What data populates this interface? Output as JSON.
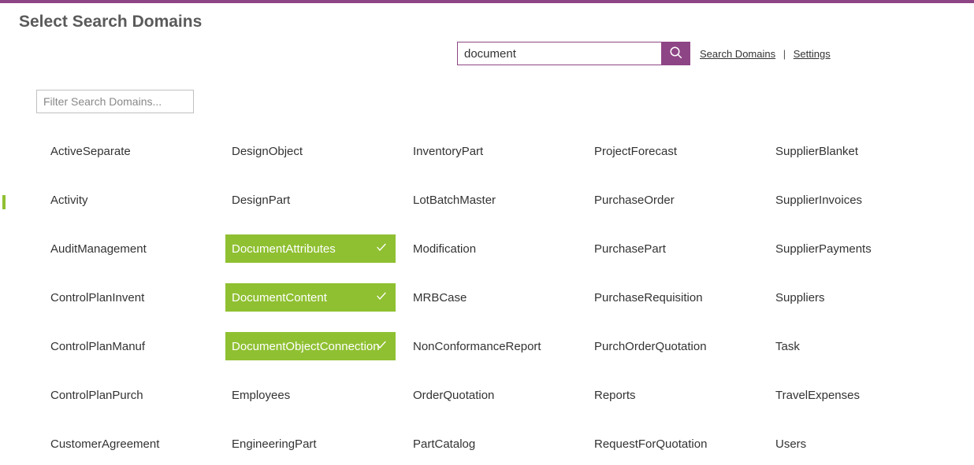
{
  "title": "Select Search Domains",
  "search": {
    "value": "document"
  },
  "links": {
    "search_domains": "Search Domains",
    "settings": "Settings"
  },
  "filter": {
    "placeholder": "Filter Search Domains..."
  },
  "domains": [
    {
      "label": "ActiveSeparate",
      "selected": false
    },
    {
      "label": "DesignObject",
      "selected": false
    },
    {
      "label": "InventoryPart",
      "selected": false
    },
    {
      "label": "ProjectForecast",
      "selected": false
    },
    {
      "label": "SupplierBlanket",
      "selected": false
    },
    {
      "label": "Activity",
      "selected": false
    },
    {
      "label": "DesignPart",
      "selected": false
    },
    {
      "label": "LotBatchMaster",
      "selected": false
    },
    {
      "label": "PurchaseOrder",
      "selected": false
    },
    {
      "label": "SupplierInvoices",
      "selected": false
    },
    {
      "label": "AuditManagement",
      "selected": false
    },
    {
      "label": "DocumentAttributes",
      "selected": true
    },
    {
      "label": "Modification",
      "selected": false
    },
    {
      "label": "PurchasePart",
      "selected": false
    },
    {
      "label": "SupplierPayments",
      "selected": false
    },
    {
      "label": "ControlPlanInvent",
      "selected": false
    },
    {
      "label": "DocumentContent",
      "selected": true
    },
    {
      "label": "MRBCase",
      "selected": false
    },
    {
      "label": "PurchaseRequisition",
      "selected": false
    },
    {
      "label": "Suppliers",
      "selected": false
    },
    {
      "label": "ControlPlanManuf",
      "selected": false
    },
    {
      "label": "DocumentObjectConnection",
      "selected": true
    },
    {
      "label": "NonConformanceReport",
      "selected": false
    },
    {
      "label": "PurchOrderQuotation",
      "selected": false
    },
    {
      "label": "Task",
      "selected": false
    },
    {
      "label": "ControlPlanPurch",
      "selected": false
    },
    {
      "label": "Employees",
      "selected": false
    },
    {
      "label": "OrderQuotation",
      "selected": false
    },
    {
      "label": "Reports",
      "selected": false
    },
    {
      "label": "TravelExpenses",
      "selected": false
    },
    {
      "label": "CustomerAgreement",
      "selected": false
    },
    {
      "label": "EngineeringPart",
      "selected": false
    },
    {
      "label": "PartCatalog",
      "selected": false
    },
    {
      "label": "RequestForQuotation",
      "selected": false
    },
    {
      "label": "Users",
      "selected": false
    }
  ]
}
